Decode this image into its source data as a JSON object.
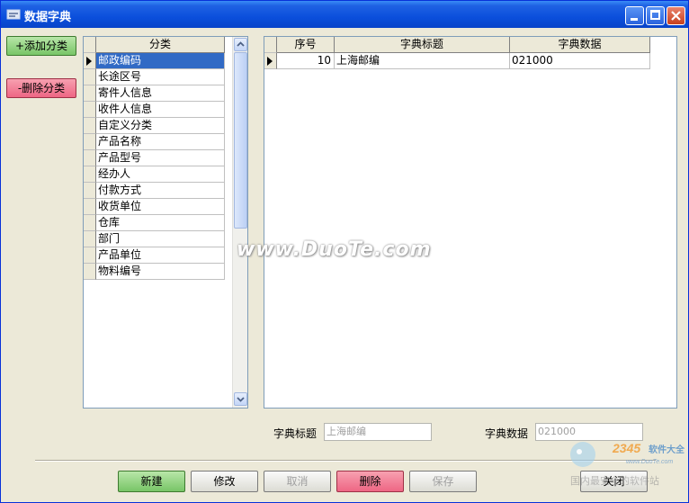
{
  "window": {
    "title": "数据字典"
  },
  "left_buttons": {
    "add_category": "+添加分类",
    "delete_category": "-删除分类"
  },
  "category_grid": {
    "header": "分类",
    "selected_index": 0,
    "items": [
      "邮政编码",
      "长途区号",
      "寄件人信息",
      "收件人信息",
      "自定义分类",
      "产品名称",
      "产品型号",
      "经办人",
      "付款方式",
      "收货单位",
      "仓库",
      "部门",
      "产品单位",
      "物料编号"
    ]
  },
  "dict_grid": {
    "headers": [
      "序号",
      "字典标题",
      "字典数据"
    ],
    "rows": [
      {
        "seq": "10",
        "title": "上海邮编",
        "data": "021000"
      }
    ]
  },
  "form": {
    "title_label": "字典标题",
    "title_value": "上海邮编",
    "data_label": "字典数据",
    "data_value": "021000"
  },
  "bottom_buttons": {
    "new": "新建",
    "edit": "修改",
    "cancel": "取消",
    "delete": "删除",
    "save": "保存",
    "close": "关闭"
  },
  "watermark": {
    "text": "www.DuoTe.com"
  },
  "logo": {
    "brand": "2345软件大全",
    "url": "www.DuoTe.com",
    "slogan": "国内最安全的软件站"
  },
  "colors": {
    "selection": "#316ac5",
    "titlebar": "#0b4fdc",
    "green_button": "#78c567",
    "pink_button": "#ee6684"
  }
}
